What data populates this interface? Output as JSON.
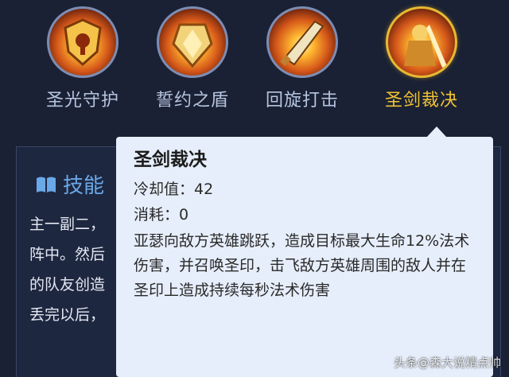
{
  "skills": [
    {
      "name": "圣光守护",
      "icon": "holy-shield-icon",
      "active": false
    },
    {
      "name": "誓约之盾",
      "icon": "oath-shield-icon",
      "active": false
    },
    {
      "name": "回旋打击",
      "icon": "spinning-strike-icon",
      "active": false
    },
    {
      "name": "圣剑裁决",
      "icon": "holy-sword-icon",
      "active": true
    }
  ],
  "panel": {
    "title": "技能",
    "icon": "book-icon",
    "lines": [
      "主一副二，",
      "阵中。然后",
      "的队友创造",
      "丢完以后，"
    ]
  },
  "tooltip": {
    "title": "圣剑裁决",
    "cooldown": "冷却值：42",
    "cost": "消耗：0",
    "description": "亚瑟向敌方英雄跳跃，造成目标最大生命12%法术伤害，并召唤圣印，击飞敌方英雄周围的敌人并在圣印上造成持续每秒法术伤害"
  },
  "watermark": "头条@森大说精点帅",
  "colors": {
    "background": "#1a2134",
    "active_gold": "#f1c232",
    "inactive_label": "#b6c4e0",
    "tooltip_bg": "#e6eefb",
    "panel_title": "#6aa8e8"
  }
}
